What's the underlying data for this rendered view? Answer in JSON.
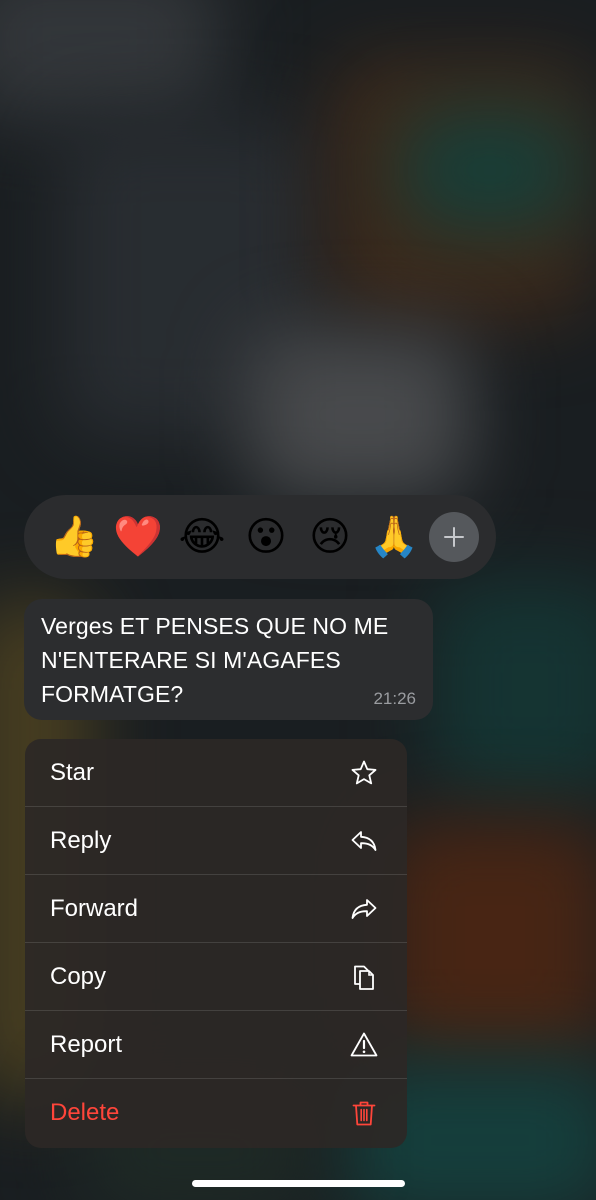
{
  "reactions": {
    "emojis": [
      "👍",
      "❤️",
      "😂",
      "😮",
      "😢",
      "🙏"
    ],
    "more_icon": "plus-icon"
  },
  "message": {
    "text": "Verges ET PENSES QUE NO ME\nN'ENTERARE SI M'AGAFES\nFORMATGE?",
    "time": "21:26"
  },
  "menu": {
    "items": [
      {
        "label": "Star",
        "icon": "star-icon"
      },
      {
        "label": "Reply",
        "icon": "reply-icon"
      },
      {
        "label": "Forward",
        "icon": "forward-icon"
      },
      {
        "label": "Copy",
        "icon": "copy-icon"
      },
      {
        "label": "Report",
        "icon": "warning-icon"
      },
      {
        "label": "Delete",
        "icon": "trash-icon"
      }
    ]
  },
  "colors": {
    "destructive": "#ff453a",
    "menu_background": "#2c2826",
    "bubble_background": "#2c2d2f"
  }
}
